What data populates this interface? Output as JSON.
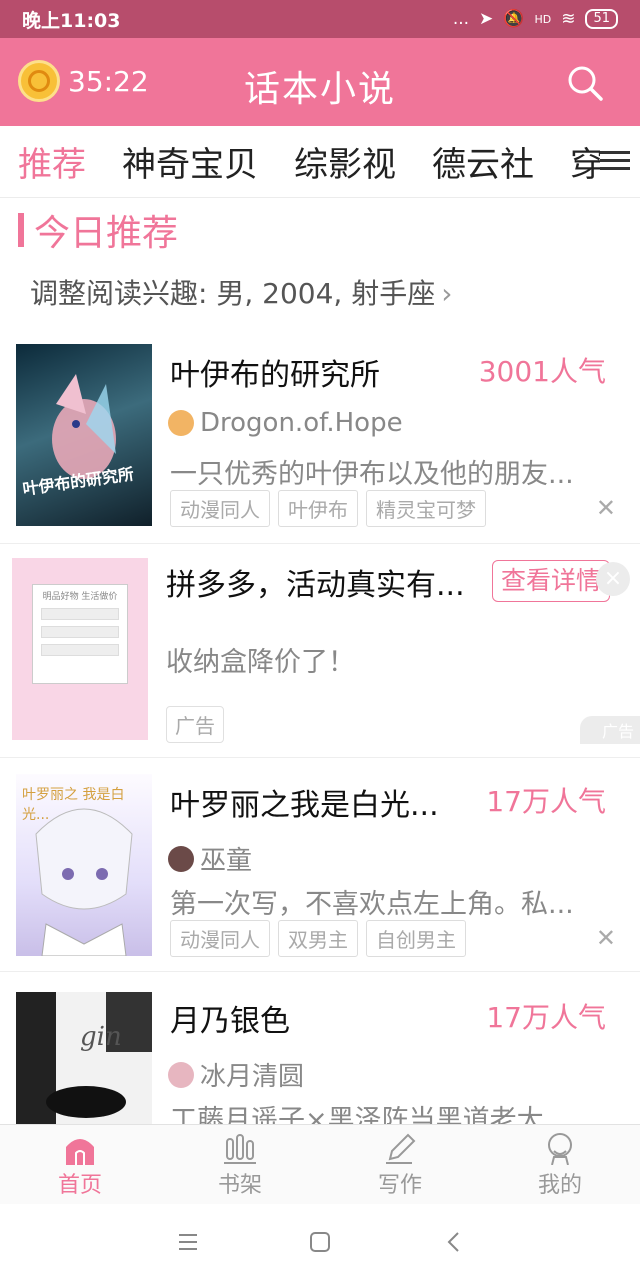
{
  "status_bar": {
    "time": "晚上11:03",
    "indicators": "...",
    "network": "HD",
    "battery": "51"
  },
  "header": {
    "timer": "35:22",
    "title": "话本小说",
    "icons": {
      "timer": "coin-alarm-icon",
      "search": "search-icon"
    }
  },
  "tabs": [
    "推荐",
    "神奇宝贝",
    "综影视",
    "德云社",
    "穿"
  ],
  "section": {
    "title": "今日推荐",
    "interest": "调整阅读兴趣: 男, 2004, 射手座"
  },
  "books": [
    {
      "title": "叶伊布的研究所",
      "popularity": "3001人气",
      "author": "Drogon.of.Hope",
      "description": "一只优秀的叶伊布以及他的朋友...",
      "tags": [
        "动漫同人",
        "叶伊布",
        "精灵宝可梦"
      ],
      "cover_text": "叶伊布的研究所"
    },
    {
      "title": "叶罗丽之我是白光...",
      "popularity": "17万人气",
      "author": "巫童",
      "description": "第一次写，不喜欢点左上角。私...",
      "tags": [
        "动漫同人",
        "双男主",
        "自创男主"
      ],
      "cover_text": "叶罗丽之 我是白光..."
    },
    {
      "title": "月乃银色",
      "popularity": "17万人气",
      "author": "冰月清圆",
      "description": "工藤月遥子×黑泽阵当黑道老大...",
      "tags": [],
      "cover_text": "gin"
    }
  ],
  "ad": {
    "title": "拼多多，活动真实有...",
    "button": "查看详情",
    "subtitle": "收纳盒降价了！",
    "tag": "广告",
    "mark": "广告",
    "close": "×",
    "cover_text": "明品好物 生活做价"
  },
  "bottom_nav": [
    {
      "label": "首页",
      "icon": "home-icon",
      "active": true
    },
    {
      "label": "书架",
      "icon": "bookshelf-icon",
      "active": false
    },
    {
      "label": "写作",
      "icon": "pen-icon",
      "active": false
    },
    {
      "label": "我的",
      "icon": "profile-icon",
      "active": false
    }
  ],
  "system_nav": [
    "menu-icon",
    "home-square-icon",
    "back-icon"
  ],
  "colors": {
    "primary": "#f07599",
    "status_bar": "#b74d6c"
  }
}
